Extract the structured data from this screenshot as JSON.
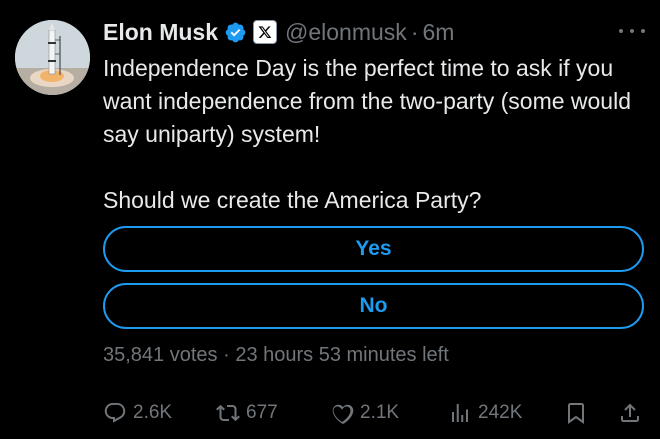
{
  "author": {
    "name": "Elon Musk",
    "handle": "@elonmusk",
    "separator": "·",
    "time": "6m",
    "avatar_icon": "rocket-launch-avatar"
  },
  "tweet": {
    "line1": "Independence Day is the perfect time to ask if you want independence from the two-party (some would say uniparty) system!",
    "line2": "Should we create the America Party?"
  },
  "poll": {
    "options": [
      {
        "label": "Yes"
      },
      {
        "label": "No"
      }
    ],
    "votes": "35,841 votes",
    "separator": "·",
    "time_left": "23 hours 53 minutes left"
  },
  "actions": {
    "replies": "2.6K",
    "reposts": "677",
    "likes": "2.1K",
    "views": "242K"
  },
  "colors": {
    "background": "#000000",
    "text": "#e7e9ea",
    "muted": "#71767b",
    "accent": "#1d9bf0"
  },
  "icons": {
    "verified": "verified-badge-icon",
    "affiliate": "x-logo-icon",
    "more": "more-options-icon",
    "reply": "reply-icon",
    "repost": "repost-icon",
    "like": "heart-icon",
    "views": "views-icon",
    "bookmark": "bookmark-icon",
    "share": "share-icon"
  }
}
